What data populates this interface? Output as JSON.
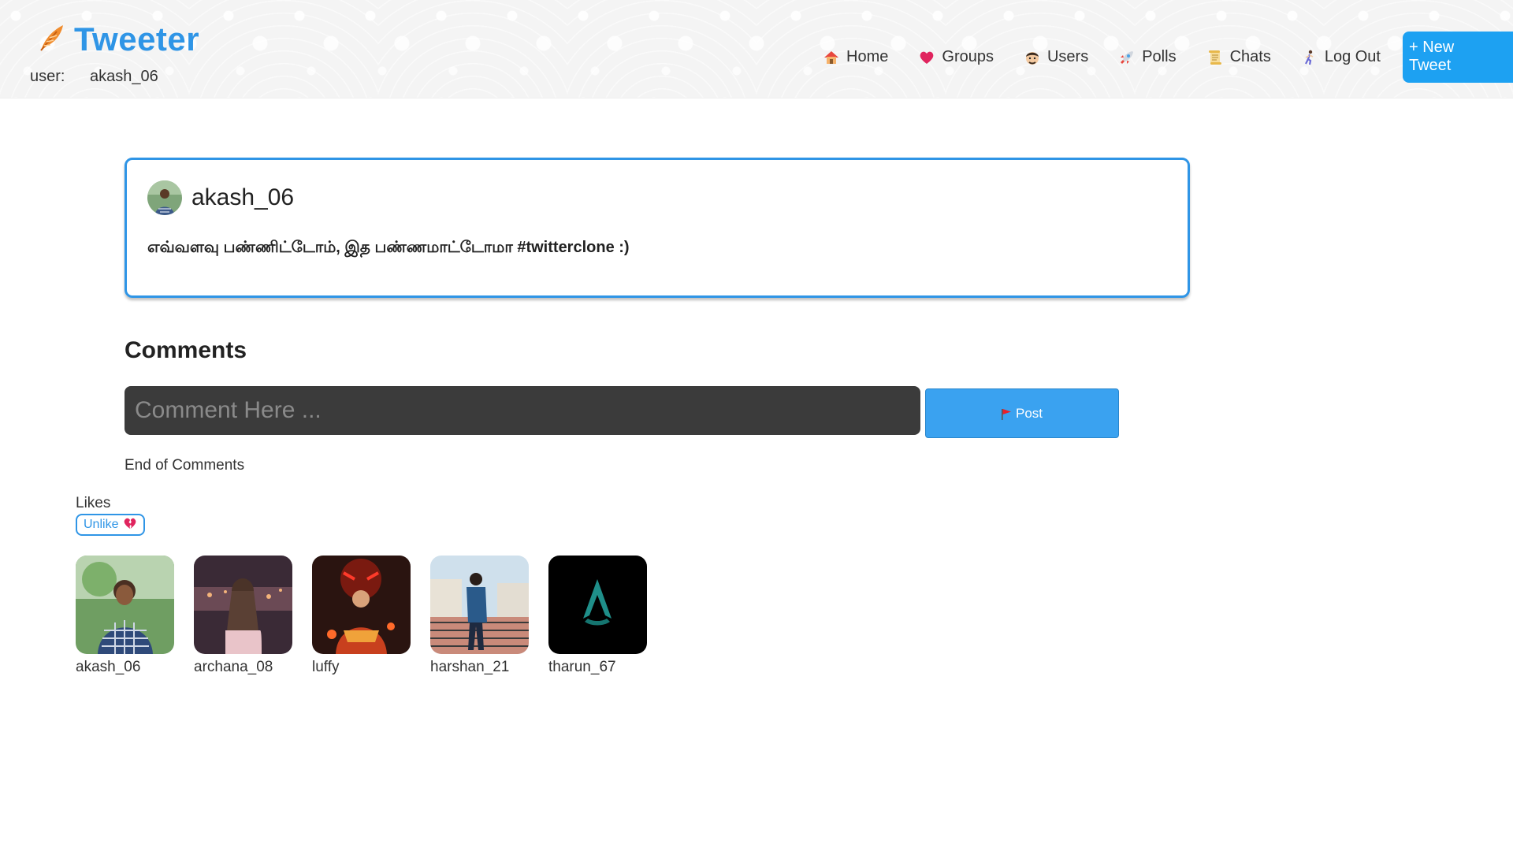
{
  "header": {
    "logo_icon": "feather-icon",
    "app_name": "Tweeter",
    "user_label": "user:",
    "username": "akash_06",
    "nav": [
      {
        "label": "Home",
        "icon": "house-icon"
      },
      {
        "label": "Groups",
        "icon": "heart-icon"
      },
      {
        "label": "Users",
        "icon": "face-icon"
      },
      {
        "label": "Polls",
        "icon": "rocket-icon"
      },
      {
        "label": "Chats",
        "icon": "scroll-icon"
      },
      {
        "label": "Log Out",
        "icon": "running-person-icon"
      }
    ],
    "new_tweet_label": "+ New Tweet"
  },
  "tweet": {
    "author": "akash_06",
    "text": "எவ்வளவு பண்ணிட்டோம், இத பண்ணமாட்டோமா #twitterclone :)"
  },
  "comments": {
    "title": "Comments",
    "placeholder": "Comment Here ...",
    "post_label": "Post",
    "end_text": "End of Comments"
  },
  "likes": {
    "label": "Likes",
    "unlike_label": "Unlike",
    "users": [
      {
        "name": "akash_06"
      },
      {
        "name": "archana_08"
      },
      {
        "name": "luffy"
      },
      {
        "name": "harshan_21"
      },
      {
        "name": "tharun_67"
      }
    ]
  },
  "colors": {
    "accent": "#1da1f2",
    "brand": "#2f95e6",
    "input_bg": "#3b3b3b"
  }
}
